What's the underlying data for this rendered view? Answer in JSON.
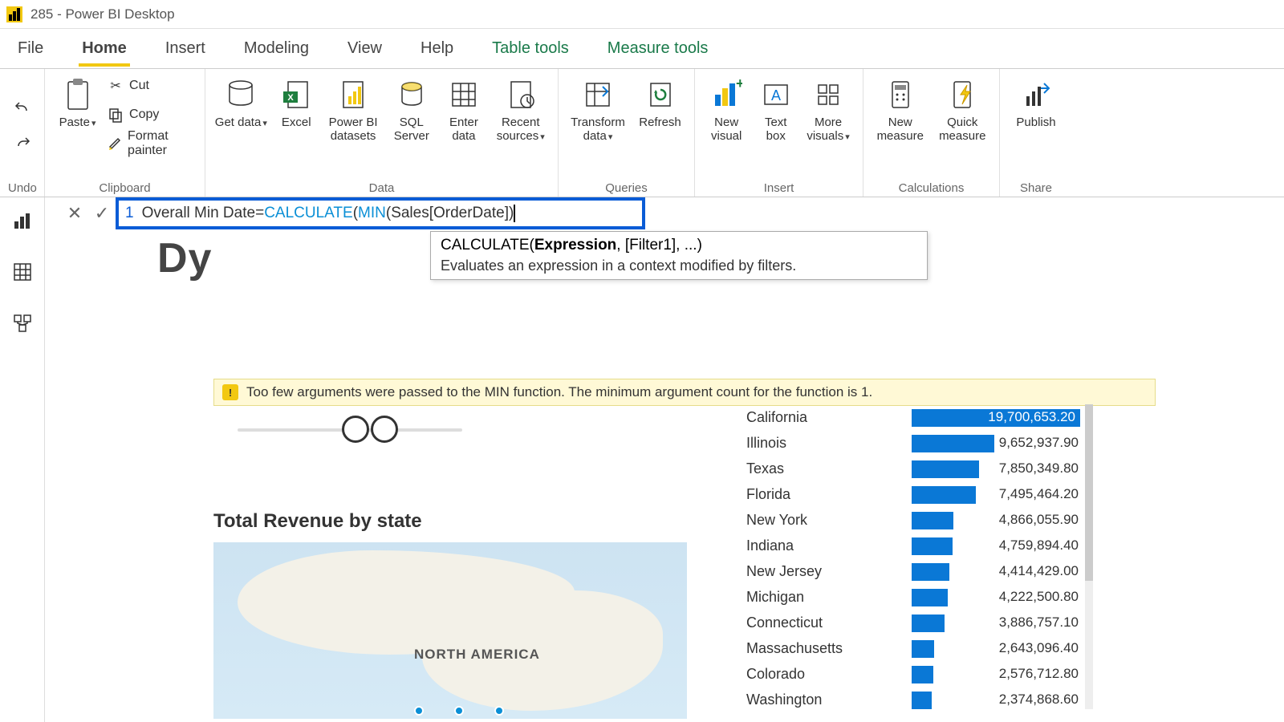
{
  "title": "285 - Power BI Desktop",
  "menu": {
    "file": "File",
    "home": "Home",
    "insert": "Insert",
    "modeling": "Modeling",
    "view": "View",
    "help": "Help",
    "tabletools": "Table tools",
    "measuretools": "Measure tools"
  },
  "ribbon": {
    "undo": "Undo",
    "clipboard": {
      "label": "Clipboard",
      "paste": "Paste",
      "cut": "Cut",
      "copy": "Copy",
      "format_painter": "Format painter"
    },
    "data": {
      "label": "Data",
      "get_data": "Get data",
      "excel": "Excel",
      "pbi_datasets": "Power BI datasets",
      "sql_server": "SQL Server",
      "enter_data": "Enter data",
      "recent_sources": "Recent sources"
    },
    "queries": {
      "label": "Queries",
      "transform": "Transform data",
      "refresh": "Refresh"
    },
    "insert": {
      "label": "Insert",
      "new_visual": "New visual",
      "text_box": "Text box",
      "more_visuals": "More visuals"
    },
    "calc": {
      "label": "Calculations",
      "new_measure": "New measure",
      "quick_measure": "Quick measure"
    },
    "share": {
      "label": "Share",
      "publish": "Publish"
    }
  },
  "formula": {
    "line": "1",
    "measure_name": "Overall Min Date",
    "eq": " = ",
    "fn1": "CALCULATE",
    "p1": "( ",
    "fn2": "MIN",
    "p2": "( ",
    "ref": "Sales[OrderDate]",
    "p3": " )",
    "tooltip_sig_pre": "CALCULATE(",
    "tooltip_sig_bold": "Expression",
    "tooltip_sig_post": ", [Filter1], ...)",
    "tooltip_desc": "Evaluates an expression in a context modified by filters."
  },
  "dy": "Dy",
  "warning": "Too few arguments were passed to the MIN function. The minimum argument count for the function is 1.",
  "map_title": "Total Revenue by state",
  "map_label": "NORTH AMERICA",
  "chart_data": {
    "type": "bar",
    "title": "",
    "categories": [
      "California",
      "Illinois",
      "Texas",
      "Florida",
      "New York",
      "Indiana",
      "New Jersey",
      "Michigan",
      "Connecticut",
      "Massachusetts",
      "Colorado",
      "Washington"
    ],
    "values": [
      19700653.2,
      9652937.9,
      7850349.8,
      7495464.2,
      4866055.9,
      4759894.4,
      4414429.0,
      4222500.8,
      3886757.1,
      2643096.4,
      2576712.8,
      2374868.6
    ],
    "display": [
      "19,700,653.20",
      "9,652,937.90",
      "7,850,349.80",
      "7,495,464.20",
      "4,866,055.90",
      "4,759,894.40",
      "4,414,429.00",
      "4,222,500.80",
      "3,886,757.10",
      "2,643,096.40",
      "2,576,712.80",
      "2,374,868.60"
    ],
    "xlabel": "",
    "ylabel": ""
  }
}
